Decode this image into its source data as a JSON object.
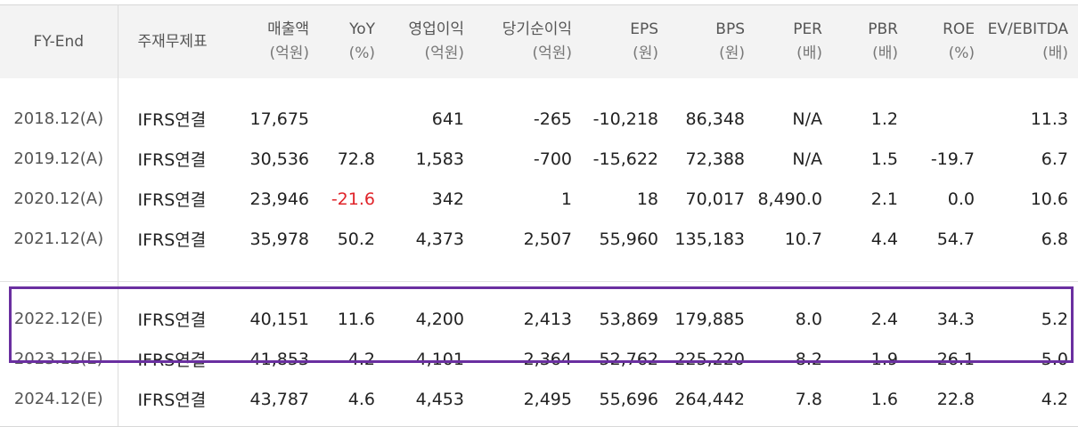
{
  "headers": [
    {
      "label": "FY-End",
      "unit": ""
    },
    {
      "label": "주재무제표",
      "unit": ""
    },
    {
      "label": "매출액",
      "unit": "(억원)"
    },
    {
      "label": "YoY",
      "unit": "(%)"
    },
    {
      "label": "영업이익",
      "unit": "(억원)"
    },
    {
      "label": "당기순이익",
      "unit": "(억원)"
    },
    {
      "label": "EPS",
      "unit": "(원)"
    },
    {
      "label": "BPS",
      "unit": "(원)"
    },
    {
      "label": "PER",
      "unit": "(배)"
    },
    {
      "label": "PBR",
      "unit": "(배)"
    },
    {
      "label": "ROE",
      "unit": "(%)"
    },
    {
      "label": "EV/EBITDA",
      "unit": "(배)"
    }
  ],
  "actual_rows": [
    [
      "2018.12(A)",
      "IFRS연결",
      "17,675",
      "",
      "641",
      "-265",
      "-10,218",
      "86,348",
      "N/A",
      "1.2",
      "",
      "11.3"
    ],
    [
      "2019.12(A)",
      "IFRS연결",
      "30,536",
      "72.8",
      "1,583",
      "-700",
      "-15,622",
      "72,388",
      "N/A",
      "1.5",
      "-19.7",
      "6.7"
    ],
    [
      "2020.12(A)",
      "IFRS연결",
      "23,946",
      "-21.6",
      "342",
      "1",
      "18",
      "70,017",
      "8,490.0",
      "2.1",
      "0.0",
      "10.6"
    ],
    [
      "2021.12(A)",
      "IFRS연결",
      "35,978",
      "50.2",
      "4,373",
      "2,507",
      "55,960",
      "135,183",
      "10.7",
      "4.4",
      "54.7",
      "6.8"
    ]
  ],
  "estimate_rows": [
    [
      "2022.12(E)",
      "IFRS연결",
      "40,151",
      "11.6",
      "4,200",
      "2,413",
      "53,869",
      "179,885",
      "8.0",
      "2.4",
      "34.3",
      "5.2"
    ],
    [
      "2023.12(E)",
      "IFRS연결",
      "41,853",
      "4.2",
      "4,101",
      "2,364",
      "52,762",
      "225,220",
      "8.2",
      "1.9",
      "26.1",
      "5.0"
    ],
    [
      "2024.12(E)",
      "IFRS연결",
      "43,787",
      "4.6",
      "4,453",
      "2,495",
      "55,696",
      "264,442",
      "7.8",
      "1.6",
      "22.8",
      "4.2"
    ]
  ],
  "colors": {
    "negative_growth": "#e0242a",
    "highlight_border": "#6a2fa0",
    "header_bg": "#f3f3f3"
  }
}
